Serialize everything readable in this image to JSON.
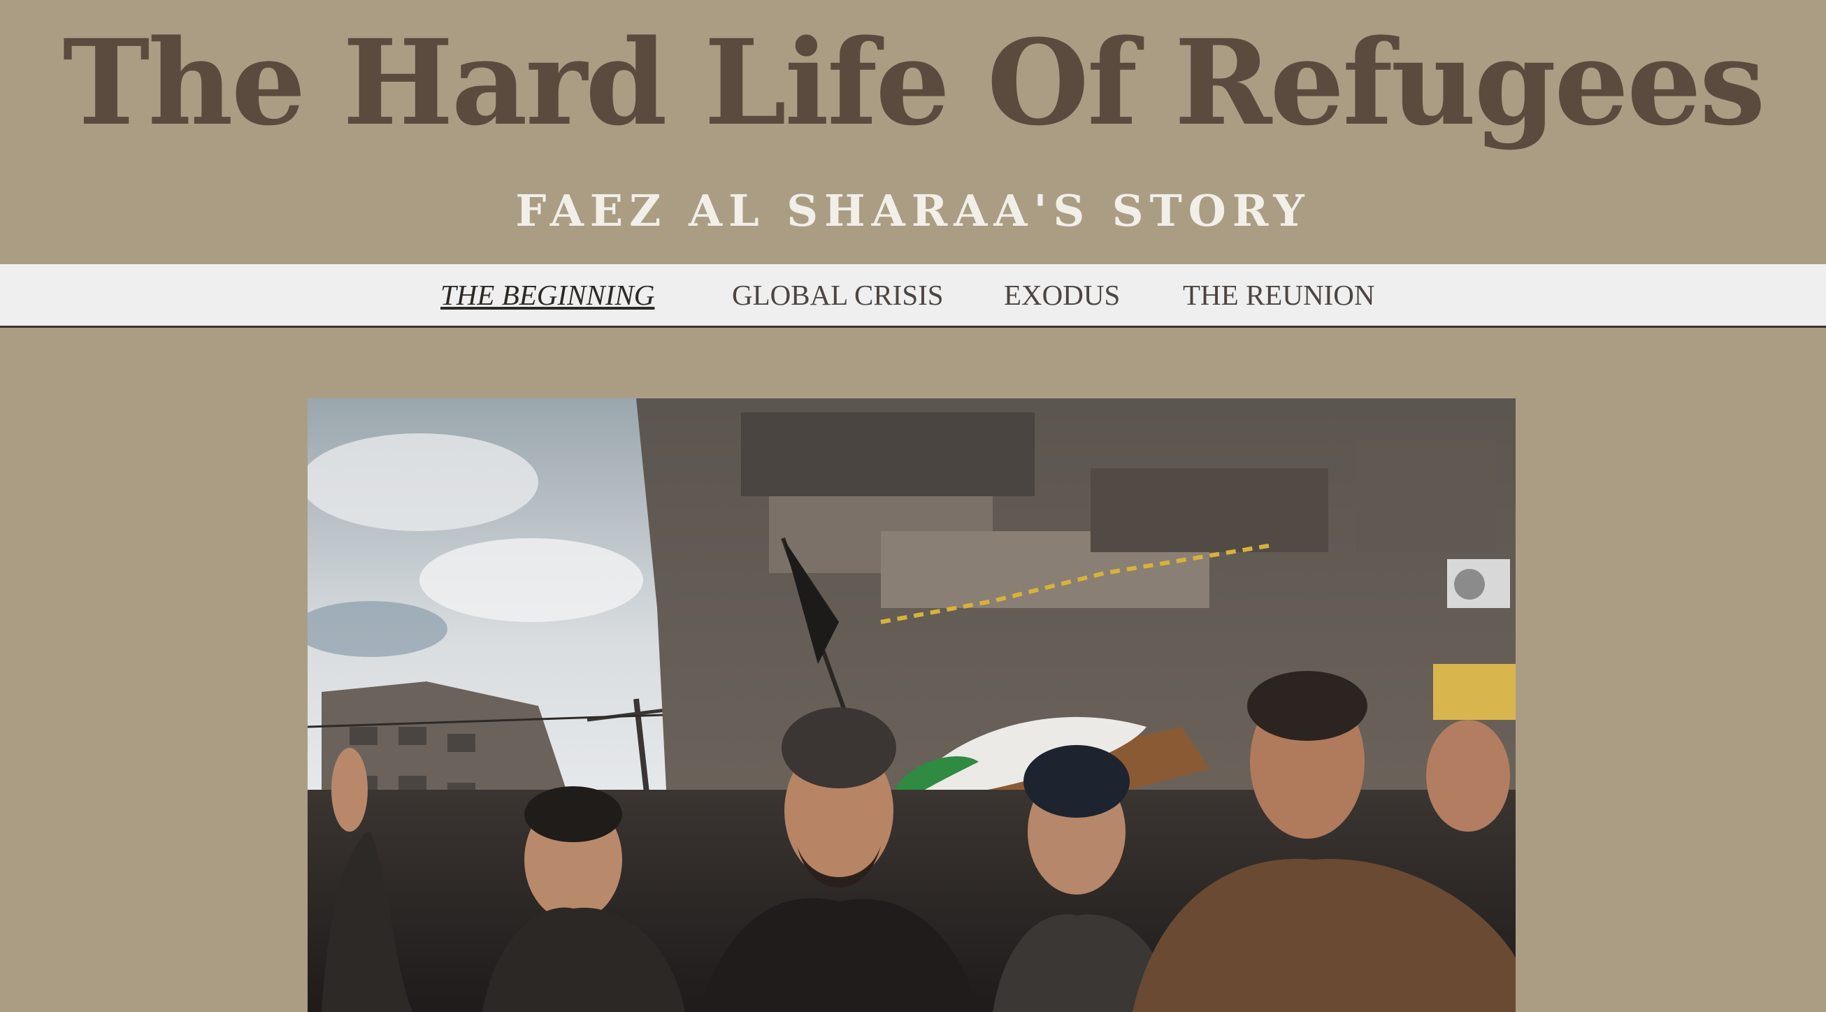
{
  "header": {
    "title": "The Hard Life Of Refugees",
    "subtitle": "FAEZ AL SHARAA'S STORY"
  },
  "nav": {
    "items": [
      {
        "label": "THE BEGINNING",
        "active": true
      },
      {
        "label": "GLOBAL CRISIS",
        "active": false
      },
      {
        "label": "EXODUS",
        "active": false
      },
      {
        "label": "THE REUNION",
        "active": false
      }
    ]
  },
  "hero": {
    "description_hidden": ""
  },
  "colors": {
    "background": "#ab9d84",
    "title": "#5b4b3f",
    "subtitle": "#f2efe9",
    "nav_bg": "#efeff0",
    "nav_text": "#4d4540"
  }
}
